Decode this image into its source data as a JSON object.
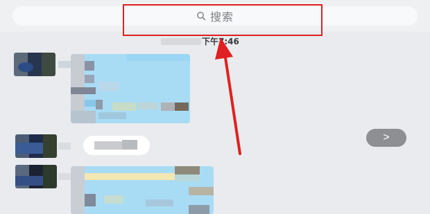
{
  "search": {
    "label": "搜索",
    "icon": "search-icon"
  },
  "chat": {
    "timestamp": "下午7:46"
  },
  "next_button": {
    "label": ">"
  },
  "colors": {
    "highlight": "#e02020",
    "bubble": "#a8dcf5",
    "background": "#e9ebee"
  }
}
